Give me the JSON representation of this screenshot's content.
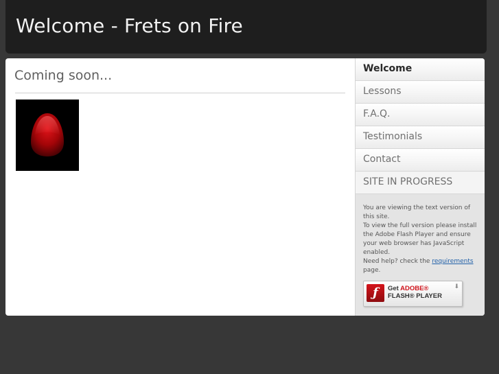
{
  "header": {
    "title": "Welcome - Frets on Fire"
  },
  "main": {
    "heading": "Coming soon..."
  },
  "nav": {
    "items": [
      {
        "label": "Welcome"
      },
      {
        "label": "Lessons"
      },
      {
        "label": "F.A.Q."
      },
      {
        "label": "Testimonials"
      },
      {
        "label": "Contact"
      },
      {
        "label": "SITE IN PROGRESS"
      }
    ]
  },
  "note": {
    "line1": "You are viewing the text version of this site.",
    "line2": "To view the full version please install the Adobe Flash Player and ensure your web browser has JavaScript enabled.",
    "line3_pre": "Need help? check the ",
    "link": "requirements",
    "line3_post": "page."
  },
  "flash_badge": {
    "get": "Get ",
    "adobe": "ADOBE®",
    "player": "FLASH® PLAYER"
  },
  "colors": {
    "background": "#373737",
    "header": "#1e1e1e",
    "pick_red": "#c0080c"
  }
}
